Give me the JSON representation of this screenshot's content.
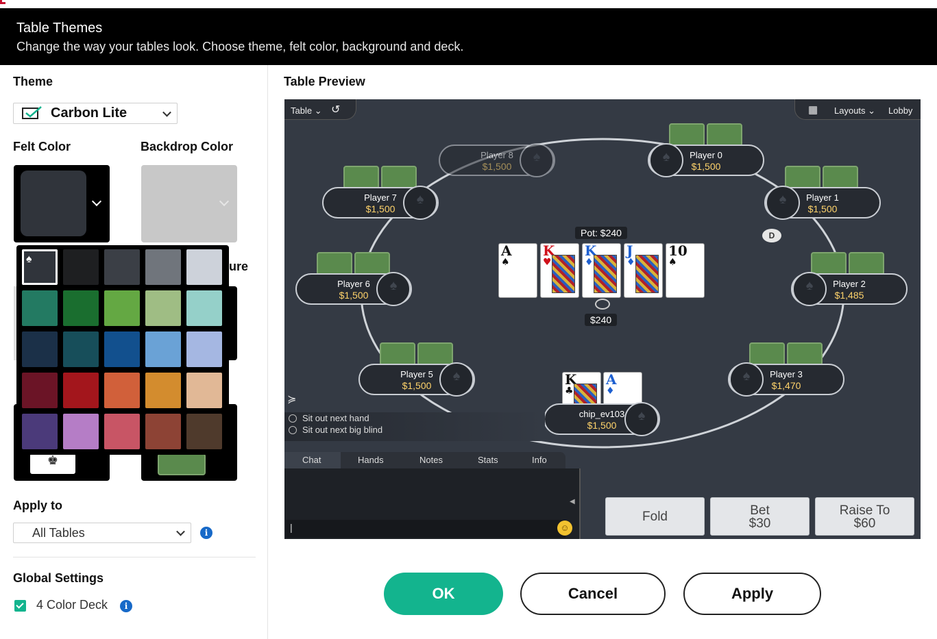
{
  "header": {
    "title": "Table Themes",
    "subtitle": "Change the way your tables look. Choose theme, felt color, background and deck."
  },
  "left": {
    "theme_label": "Theme",
    "theme_value": "Carbon Lite",
    "felt_label": "Felt Color",
    "backdrop_label": "Backdrop Color",
    "hidden_label_partial": "ure",
    "apply_to_label": "Apply to",
    "apply_to_value": "All Tables",
    "global_label": "Global Settings",
    "four_color_label": "4 Color Deck",
    "info_glyph": "i",
    "felt_color": "#30343b"
  },
  "palette": {
    "colors": [
      "#30343b",
      "#1e1f21",
      "#3b3f46",
      "#70757c",
      "#cdd2da",
      "#237a62",
      "#1a6e2f",
      "#64a843",
      "#9fbd84",
      "#95d0c9",
      "#1b3048",
      "#174e5a",
      "#12508e",
      "#6aa2d6",
      "#a5b7e2",
      "#6b1426",
      "#a3161c",
      "#d1603a",
      "#d38c2e",
      "#e1b896",
      "#4b3a7a",
      "#b57dc6",
      "#c85565",
      "#8d4335",
      "#4f3a2c"
    ],
    "selected_icon": "♠"
  },
  "preview": {
    "title": "Table Preview",
    "table_menu": "Table",
    "layouts_menu": "Layouts",
    "lobby": "Lobby",
    "pot": "Pot: $240",
    "bet_amount": "$240",
    "dealer": "D",
    "players": [
      {
        "name": "Player 8",
        "stack": "$1,500"
      },
      {
        "name": "Player 0",
        "stack": "$1,500"
      },
      {
        "name": "Player 7",
        "stack": "$1,500"
      },
      {
        "name": "Player 1",
        "stack": "$1,500"
      },
      {
        "name": "Player 6",
        "stack": "$1,500"
      },
      {
        "name": "Player 2",
        "stack": "$1,485"
      },
      {
        "name": "Player 5",
        "stack": "$1,500"
      },
      {
        "name": "Player 3",
        "stack": "$1,470"
      },
      {
        "name": "chip_ev103",
        "stack": "$1,500"
      }
    ],
    "board": [
      {
        "rank": "A",
        "suit": "♠",
        "color": "#111"
      },
      {
        "rank": "K",
        "suit": "♥",
        "color": "#d0101a"
      },
      {
        "rank": "K",
        "suit": "♦",
        "color": "#1d5fd0"
      },
      {
        "rank": "J",
        "suit": "♦",
        "color": "#1d5fd0"
      },
      {
        "rank": "10",
        "suit": "♠",
        "color": "#111"
      }
    ],
    "hole": [
      {
        "rank": "K",
        "suit": "♣",
        "color": "#111"
      },
      {
        "rank": "A",
        "suit": "♦",
        "color": "#1d5fd0"
      }
    ],
    "sit_out_hand": "Sit out next hand",
    "sit_out_bb": "Sit out next big blind",
    "tabs": [
      "Chat",
      "Hands",
      "Notes",
      "Stats",
      "Info"
    ],
    "fold": "Fold",
    "bet": "Bet",
    "bet_val": "$30",
    "raise": "Raise To",
    "raise_val": "$60",
    "chat_cursor": "|"
  },
  "footer": {
    "ok": "OK",
    "cancel": "Cancel",
    "apply": "Apply"
  }
}
